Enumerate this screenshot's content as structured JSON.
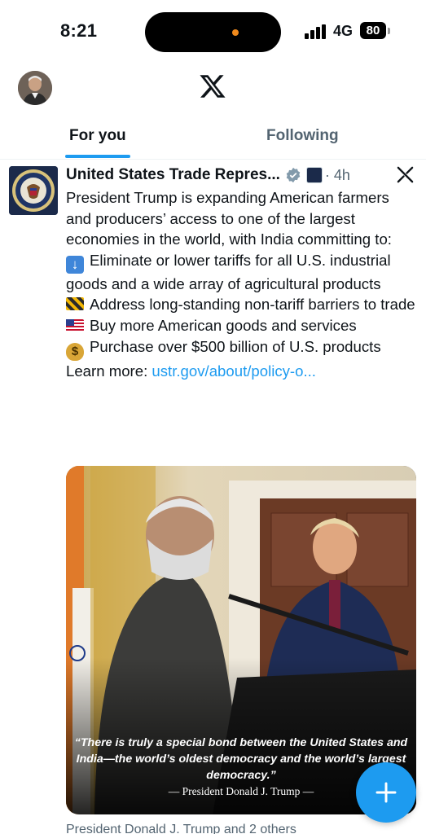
{
  "status_bar": {
    "time": "8:21",
    "network": "4G",
    "battery": "80"
  },
  "header": {
    "logo_icon": "x-logo-icon"
  },
  "tabs": [
    {
      "label": "For you",
      "active": true
    },
    {
      "label": "Following",
      "active": false
    }
  ],
  "tweet": {
    "author": "United States Trade Repres...",
    "time": "· 4h",
    "intro": "President Trump is expanding American farmers and producers’ access to one of the largest economies in the world, with India committing to:",
    "points": [
      {
        "icon": "down-arrow-emoji",
        "text": "Eliminate or lower tariffs for all U.S. industrial goods and a wide array of agricultural products"
      },
      {
        "icon": "construction-barrier-emoji",
        "text": "Address long-standing non-tariff barriers to trade"
      },
      {
        "icon": "us-flag-emoji",
        "text": "Buy more American goods and services"
      },
      {
        "icon": "money-bag-emoji",
        "text": "Purchase over $500 billion of U.S. products"
      }
    ],
    "learn_more_label": "Learn more: ",
    "learn_more_link": "ustr.gov/about/policy-o...",
    "media": {
      "quote": "“There is truly a special bond between the United States and India—the world’s oldest democracy and the world’s largest democracy.”",
      "attribution": "— President Donald J. Trump —"
    },
    "next_line": "President Donald J. Trump and 2 others"
  },
  "colors": {
    "accent": "#1d9bf0",
    "text": "#0f1419",
    "muted": "#536471"
  }
}
